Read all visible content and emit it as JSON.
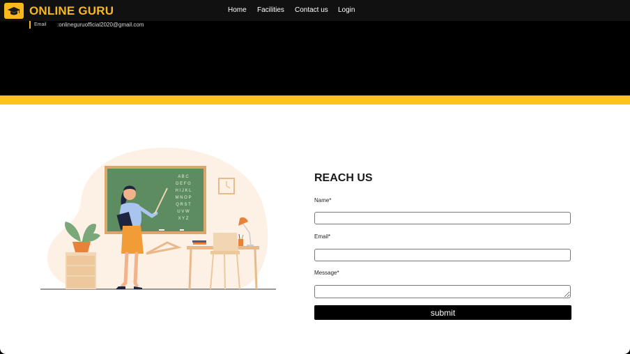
{
  "nav": {
    "brand": "ONLINE GURU",
    "links": [
      "Home",
      "Facilities",
      "Contact us",
      "Login"
    ]
  },
  "contact_bar": {
    "email_label": "Email",
    "email_value": ":onlineguruofficial2020@gmail.com"
  },
  "illustration": {
    "board_letters": [
      "A B C",
      "D E F G",
      "H I J K L",
      "M N O P",
      "Q R S T",
      "U V W",
      "X Y Z"
    ]
  },
  "form": {
    "heading": "REACH US",
    "name_label": "Name*",
    "email_label": "Email*",
    "message_label": "Message*",
    "submit_label": "submit"
  },
  "colors": {
    "accent": "#fcc419",
    "brand": "#f9b81b",
    "header_bg": "#111111"
  }
}
